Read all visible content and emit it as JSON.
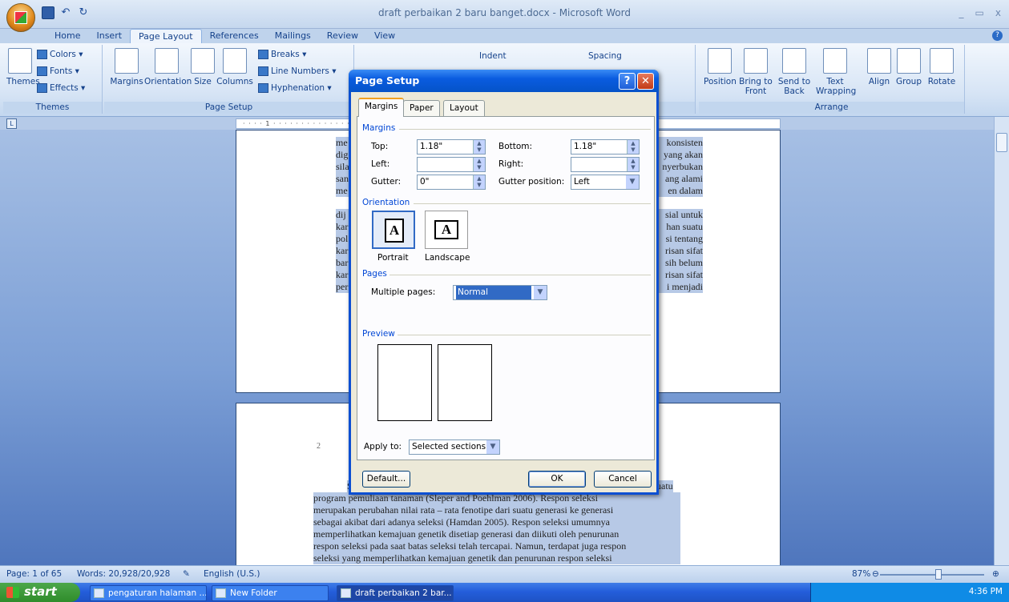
{
  "window": {
    "title": "draft perbaikan 2 baru banget.docx - Microsoft Word",
    "controls": [
      "_",
      "▭",
      "x"
    ]
  },
  "ribbon": {
    "tabs": [
      "Home",
      "Insert",
      "Page Layout",
      "References",
      "Mailings",
      "Review",
      "View"
    ],
    "active_tab": "Page Layout",
    "themes": {
      "group": "Themes",
      "themes_label": "Themes",
      "colors": "Colors",
      "fonts": "Fonts",
      "effects": "Effects"
    },
    "page_setup": {
      "group": "Page Setup",
      "margins": "Margins",
      "orientation": "Orientation",
      "size": "Size",
      "columns": "Columns",
      "breaks": "Breaks",
      "line_numbers": "Line Numbers",
      "hyphenation": "Hyphenation"
    },
    "paragraph": {
      "indent": "Indent",
      "spacing": "Spacing"
    },
    "arrange": {
      "group": "Arrange",
      "position": "Position",
      "bring_to_front": "Bring to Front",
      "send_to_back": "Send to Back",
      "text_wrapping": "Text Wrapping",
      "align": "Align",
      "group_btn": "Group",
      "rotate": "Rotate"
    }
  },
  "document": {
    "page1_right_lines": [
      "konsisten",
      "yang akan",
      "nyerbukan",
      "ang alami",
      "en dalam",
      "",
      "sial untuk",
      "han suatu",
      "si tentang",
      "risan sifat",
      "sih belum",
      "risan sifat",
      "i menjadi"
    ],
    "page1_left_lines": [
      "me",
      "dig",
      "sila",
      "san",
      "me",
      "",
      "dij",
      "kar",
      "pol",
      "kar",
      "bar",
      "kar",
      "per"
    ],
    "page2_number": "2",
    "page2_partial": "S",
    "page2_partial_right": "uatu",
    "page2_lines": [
      "program pemuliaan tanaman (Sleper and Poehlman 2006). Respon seleksi",
      "merupakan perubahan nilai rata – rata fenotipe dari suatu generasi ke generasi",
      "sebagai akibat dari adanya seleksi (Hamdan 2005). Respon seleksi umumnya",
      "memperlihatkan kemajuan genetik disetiap generasi dan diikuti oleh penurunan",
      "respon seleksi pada saat batas seleksi telah tercapai. Namun, terdapat juga respon",
      "seleksi yang memperlihatkan kemajuan genetik dan penurunan respon seleksi"
    ]
  },
  "statusbar": {
    "page": "Page: 1 of 65",
    "words": "Words: 20,928/20,928",
    "language": "English (U.S.)",
    "zoom": "87%",
    "zoom_level": 0.55
  },
  "taskbar": {
    "start": "start",
    "buttons": [
      "pengaturan halaman ...",
      "New Folder",
      "draft perbaikan 2 bar..."
    ],
    "active_button": "draft perbaikan 2 bar...",
    "clock": "4:36 PM"
  },
  "dialog": {
    "title": "Page Setup",
    "tabs": [
      "Margins",
      "Paper",
      "Layout"
    ],
    "active_tab": "Margins",
    "margins_section": "Margins",
    "top_label": "Top:",
    "top_value": "1.18\"",
    "bottom_label": "Bottom:",
    "bottom_value": "1.18\"",
    "left_label": "Left:",
    "left_value": "",
    "right_label": "Right:",
    "right_value": "",
    "gutter_label": "Gutter:",
    "gutter_value": "0\"",
    "gutter_position_label": "Gutter position:",
    "gutter_position_value": "Left",
    "orientation_section": "Orientation",
    "portrait": "Portrait",
    "landscape": "Landscape",
    "orientation_selected": "Portrait",
    "pages_section": "Pages",
    "multiple_pages_label": "Multiple pages:",
    "multiple_pages_value": "Normal",
    "preview_section": "Preview",
    "apply_to_label": "Apply to:",
    "apply_to_value": "Selected sections",
    "default_button": "Default...",
    "ok_button": "OK",
    "cancel_button": "Cancel"
  },
  "colors": {
    "dialog_title": "#0a5ce0",
    "selection": "#316ac5",
    "ribbon": "#d6e4f5",
    "taskbar": "#245edb"
  }
}
